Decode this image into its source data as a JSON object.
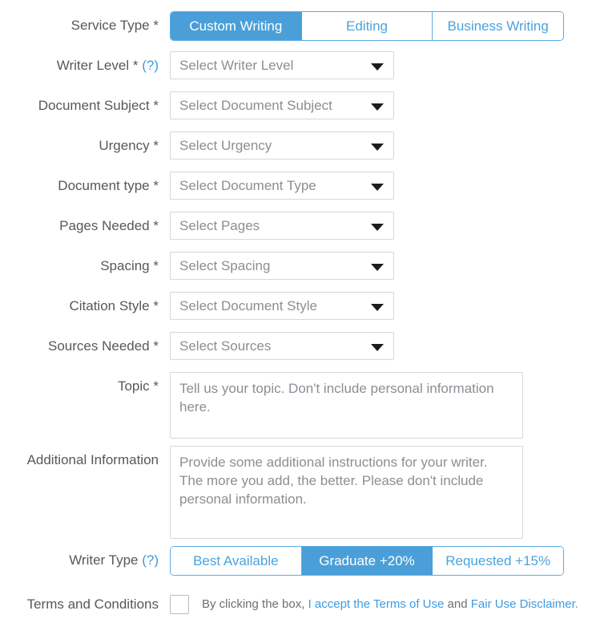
{
  "form": {
    "service_type": {
      "label": "Service Type",
      "required_mark": "*",
      "options": [
        {
          "label": "Custom Writing",
          "active": true
        },
        {
          "label": "Editing",
          "active": false
        },
        {
          "label": "Business Writing",
          "active": false
        }
      ]
    },
    "writer_level": {
      "label": "Writer Level",
      "required_mark": "*",
      "help_mark": "(?)",
      "value": "Select Writer Level"
    },
    "document_subject": {
      "label": "Document Subject",
      "required_mark": "*",
      "value": "Select Document Subject"
    },
    "urgency": {
      "label": "Urgency",
      "required_mark": "*",
      "value": "Select Urgency"
    },
    "document_type": {
      "label": "Document type",
      "required_mark": "*",
      "value": "Select Document Type"
    },
    "pages_needed": {
      "label": "Pages Needed",
      "required_mark": "*",
      "value": "Select Pages"
    },
    "spacing": {
      "label": "Spacing",
      "required_mark": "*",
      "value": "Select Spacing"
    },
    "citation_style": {
      "label": "Citation Style",
      "required_mark": "*",
      "value": "Select Document Style"
    },
    "sources_needed": {
      "label": "Sources Needed",
      "required_mark": "*",
      "value": "Select Sources"
    },
    "topic": {
      "label": "Topic",
      "required_mark": "*",
      "placeholder": "Tell us your topic. Don't include personal information here.",
      "value": ""
    },
    "additional_information": {
      "label": "Additional Information",
      "placeholder": "Provide some additional instructions for your writer. The more you add, the better. Please don't include personal information.",
      "value": ""
    },
    "writer_type": {
      "label": "Writer Type",
      "help_mark": "(?)",
      "options": [
        {
          "label": "Best Available",
          "active": false
        },
        {
          "label": "Graduate +20%",
          "active": true
        },
        {
          "label": "Requested +15%",
          "active": false
        }
      ]
    },
    "terms": {
      "label": "Terms and Conditions",
      "checked": false,
      "text_before": "By clicking the box, ",
      "link_terms": "I accept the Terms of Use",
      "text_middle": " and ",
      "link_fairuse": "Fair Use Disclaimer."
    }
  },
  "colors": {
    "accent_blue": "#4a9fd8",
    "link_blue": "#3d9be3",
    "label_gray": "#55595c",
    "placeholder_gray": "#8a8f94",
    "border_gray": "#d5d8da"
  },
  "icons": {
    "caret": "chevron-down-icon",
    "checkbox": "checkbox-icon"
  }
}
